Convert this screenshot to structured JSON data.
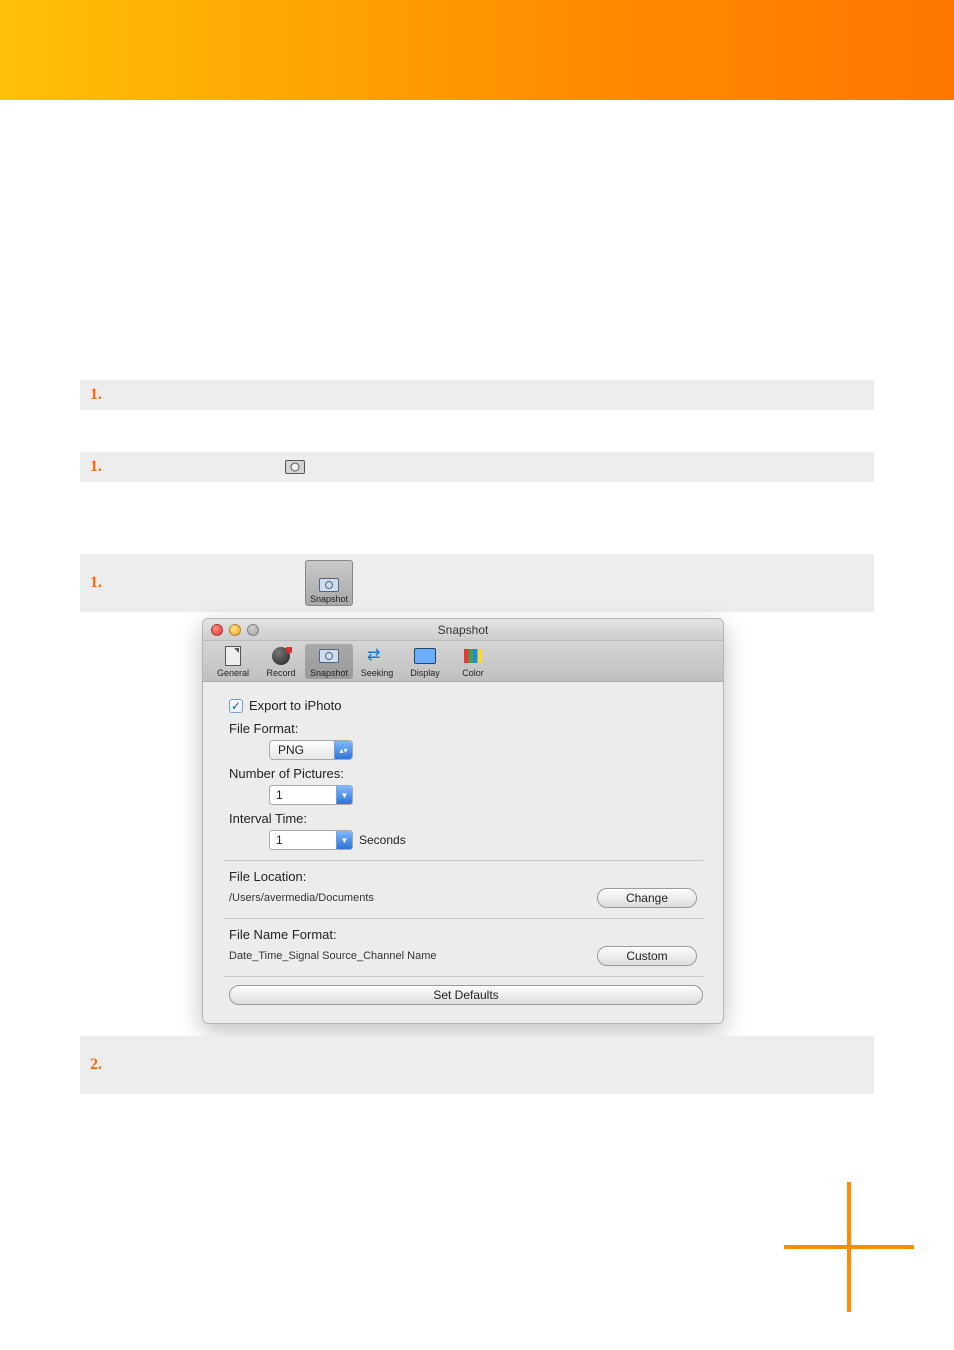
{
  "steps": {
    "first": {
      "num": "1."
    },
    "second": {
      "num": "1."
    },
    "third": {
      "num": "1.",
      "tile_label": "Snapshot"
    },
    "last": {
      "num": "2."
    }
  },
  "window": {
    "title": "Snapshot",
    "tabs": [
      {
        "label": "General"
      },
      {
        "label": "Record"
      },
      {
        "label": "Snapshot"
      },
      {
        "label": "Seeking"
      },
      {
        "label": "Display"
      },
      {
        "label": "Color"
      }
    ],
    "export_label": "Export to iPhoto",
    "file_format_label": "File Format:",
    "file_format_value": "PNG",
    "num_pictures_label": "Number of Pictures:",
    "num_pictures_value": "1",
    "interval_label": "Interval Time:",
    "interval_value": "1",
    "interval_unit": "Seconds",
    "file_location_label": "File Location:",
    "file_location_value": "/Users/avermedia/Documents",
    "change_btn": "Change",
    "file_name_format_label": "File Name Format:",
    "file_name_format_value": "Date_Time_Signal Source_Channel Name",
    "custom_btn": "Custom",
    "set_defaults_btn": "Set Defaults"
  }
}
